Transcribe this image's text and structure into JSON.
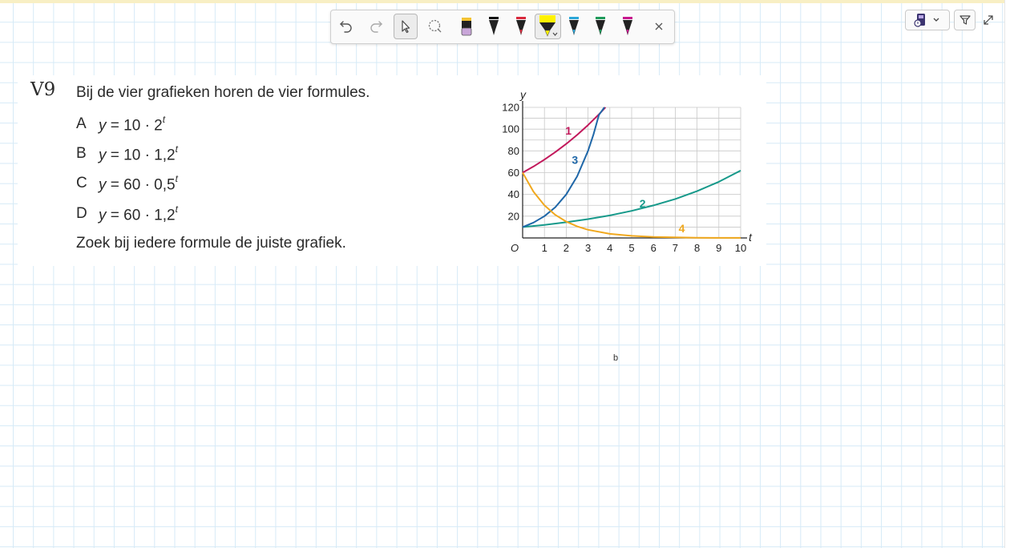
{
  "toolbar": {
    "tools": [
      {
        "name": "undo-icon"
      },
      {
        "name": "redo-icon"
      },
      {
        "name": "select-pointer-icon",
        "selected": true
      },
      {
        "name": "lasso-icon"
      },
      {
        "name": "pen-purple-icon",
        "color": "#c9a6d9"
      },
      {
        "name": "pen-black-icon",
        "color": "#111111"
      },
      {
        "name": "pen-red-icon",
        "color": "#d8283c"
      },
      {
        "name": "highlighter-yellow-icon",
        "color": "#fff200",
        "selected": true
      },
      {
        "name": "pen-blue-icon",
        "color": "#2aa6d8"
      },
      {
        "name": "pen-green-icon",
        "color": "#1e9a5a"
      },
      {
        "name": "pen-magenta-icon",
        "color": "#c6168d"
      },
      {
        "name": "close-icon"
      }
    ]
  },
  "exercise": {
    "number": "V9",
    "intro": "Bij de vier grafieken horen de vier formules.",
    "options": [
      {
        "letter": "A",
        "lhs": "y",
        "rhs": " = 10 · 2",
        "exp": "t"
      },
      {
        "letter": "B",
        "lhs": "y",
        "rhs": " = 10 · 1,2",
        "exp": "t"
      },
      {
        "letter": "C",
        "lhs": "y",
        "rhs": " = 60 · 0,5",
        "exp": "t"
      },
      {
        "letter": "D",
        "lhs": "y",
        "rhs": " = 60 · 1,2",
        "exp": "t"
      }
    ],
    "instruction": "Zoek bij iedere formule de juiste grafiek."
  },
  "stray_text": "b",
  "chart_data": {
    "type": "line",
    "xlabel": "t",
    "ylabel": "y",
    "origin_label": "O",
    "xlim": [
      0,
      10
    ],
    "ylim": [
      0,
      120
    ],
    "x_ticks": [
      1,
      2,
      3,
      4,
      5,
      6,
      7,
      8,
      9,
      10
    ],
    "y_ticks": [
      20,
      40,
      60,
      80,
      100,
      120
    ],
    "grid": true,
    "series": [
      {
        "name": "1",
        "color": "#c2185b",
        "x": [
          0,
          0.5,
          1,
          1.5,
          2,
          2.5,
          3,
          3.5,
          3.8
        ],
        "y": [
          60,
          65.7,
          72,
          78.9,
          86.4,
          94.7,
          103.7,
          113.6,
          120
        ]
      },
      {
        "name": "2",
        "color": "#16998a",
        "x": [
          0,
          1,
          2,
          3,
          4,
          5,
          6,
          7,
          8,
          9,
          10
        ],
        "y": [
          10,
          12,
          14.4,
          17.3,
          20.7,
          24.9,
          29.9,
          35.8,
          43,
          51.6,
          61.9
        ]
      },
      {
        "name": "3",
        "color": "#1f67a8",
        "x": [
          0,
          0.5,
          1,
          1.5,
          2,
          2.5,
          3,
          3.25,
          3.5,
          3.75
        ],
        "y": [
          10,
          14.1,
          20,
          28.3,
          40,
          56.6,
          80,
          95.1,
          113.1,
          120
        ]
      },
      {
        "name": "4",
        "color": "#f0a81e",
        "x": [
          0,
          0.5,
          1,
          1.5,
          2,
          2.5,
          3,
          4,
          5,
          6,
          7,
          8,
          9,
          10
        ],
        "y": [
          60,
          42.4,
          30,
          21.2,
          15,
          10.6,
          7.5,
          3.75,
          1.9,
          0.9,
          0.5,
          0.2,
          0.1,
          0.06
        ]
      }
    ]
  }
}
